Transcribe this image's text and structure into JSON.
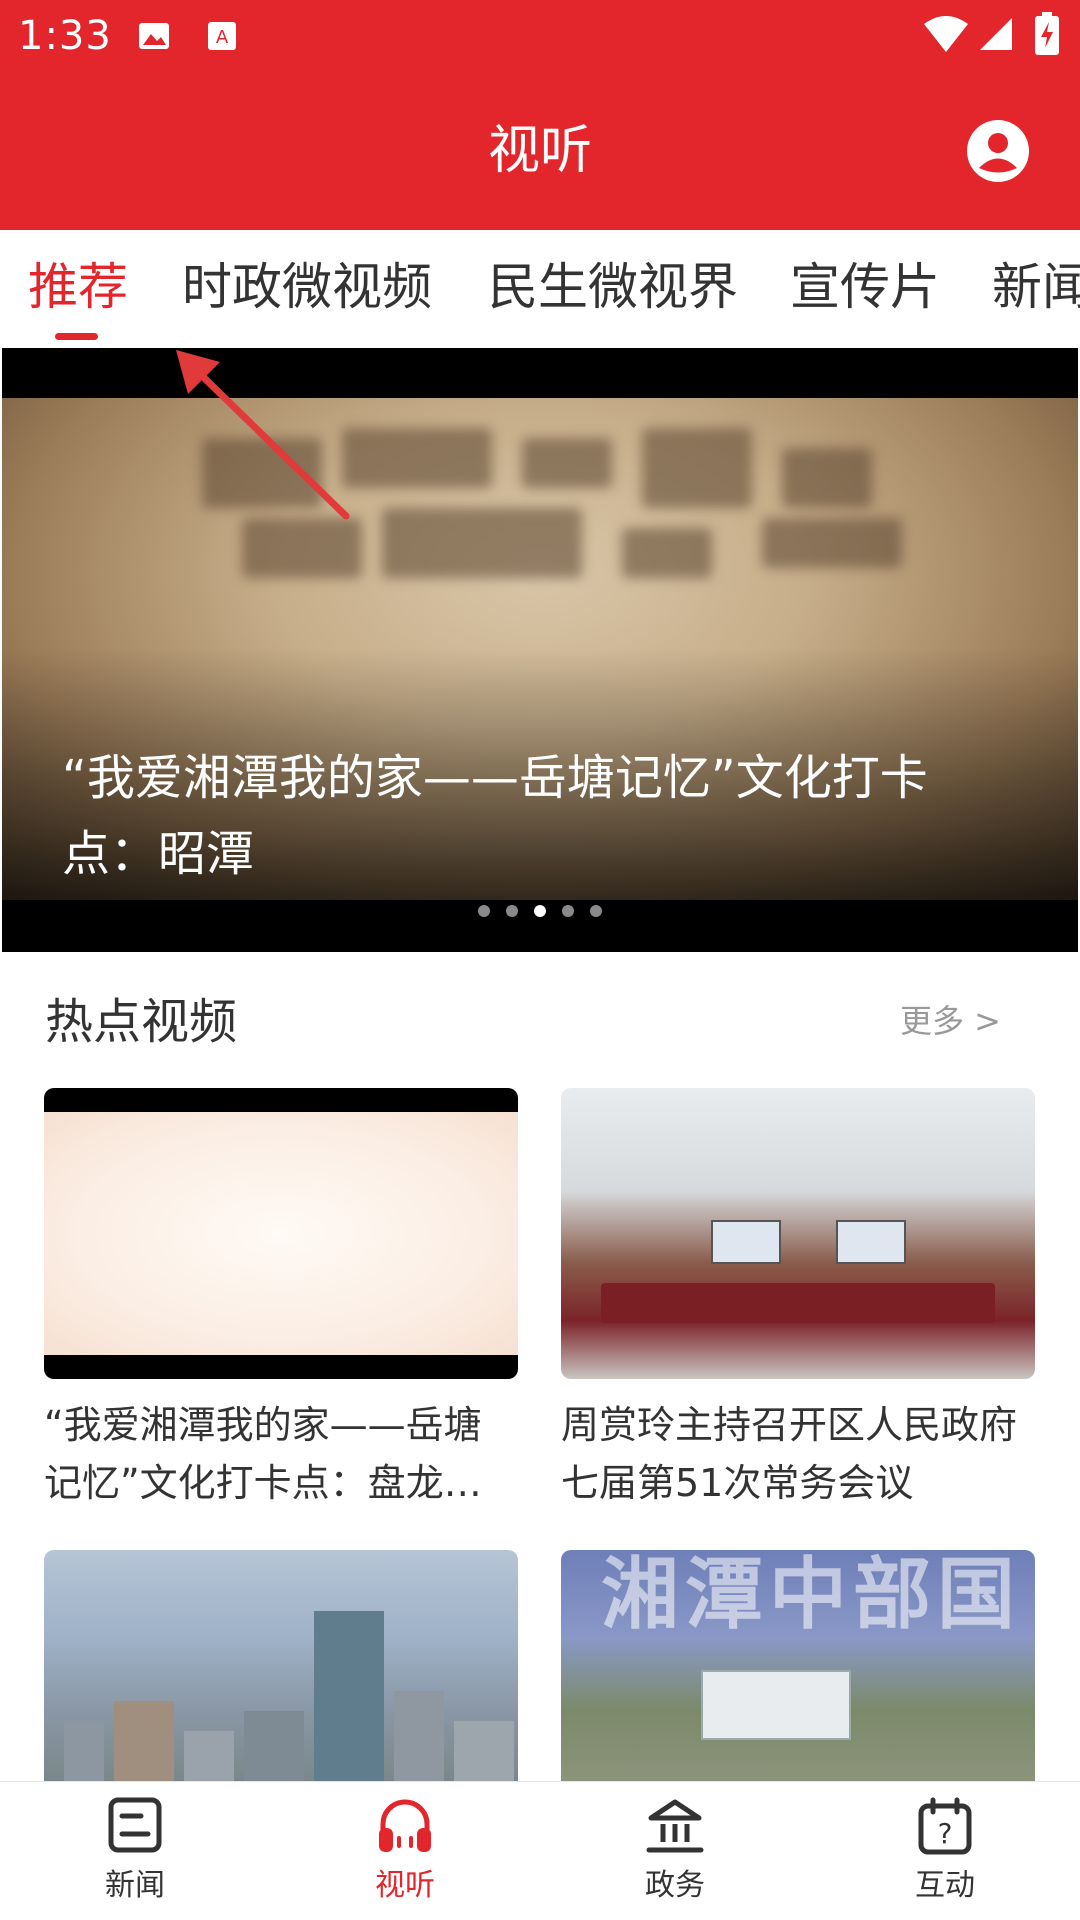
{
  "status_bar": {
    "time": "1:33"
  },
  "header": {
    "title": "视听"
  },
  "tabs": [
    {
      "label": "推荐"
    },
    {
      "label": "时政微视频"
    },
    {
      "label": "民生微视界"
    },
    {
      "label": "宣传片"
    },
    {
      "label": "新闻"
    }
  ],
  "hero": {
    "caption": "“我爱湘潭我的家——岳塘记忆”文化打卡点：昭潭",
    "dots": 5,
    "active_dot": 3
  },
  "hot_section": {
    "title": "热点视频",
    "more_label": "更多 >",
    "cards": [
      {
        "title": "“我爱湘潭我的家——岳塘记忆”文化打卡点：盘龙…"
      },
      {
        "title": "周赏玲主持召开区人民政府七届第51次常务会议"
      },
      {
        "title": ""
      },
      {
        "title": ""
      }
    ],
    "card4_overlay_text": "湘潭中部国"
  },
  "bottom_nav": [
    {
      "label": "新闻"
    },
    {
      "label": "视听"
    },
    {
      "label": "政务"
    },
    {
      "label": "互动"
    }
  ],
  "colors": {
    "primary": "#e2262b",
    "text": "#333333",
    "muted": "#999999"
  }
}
